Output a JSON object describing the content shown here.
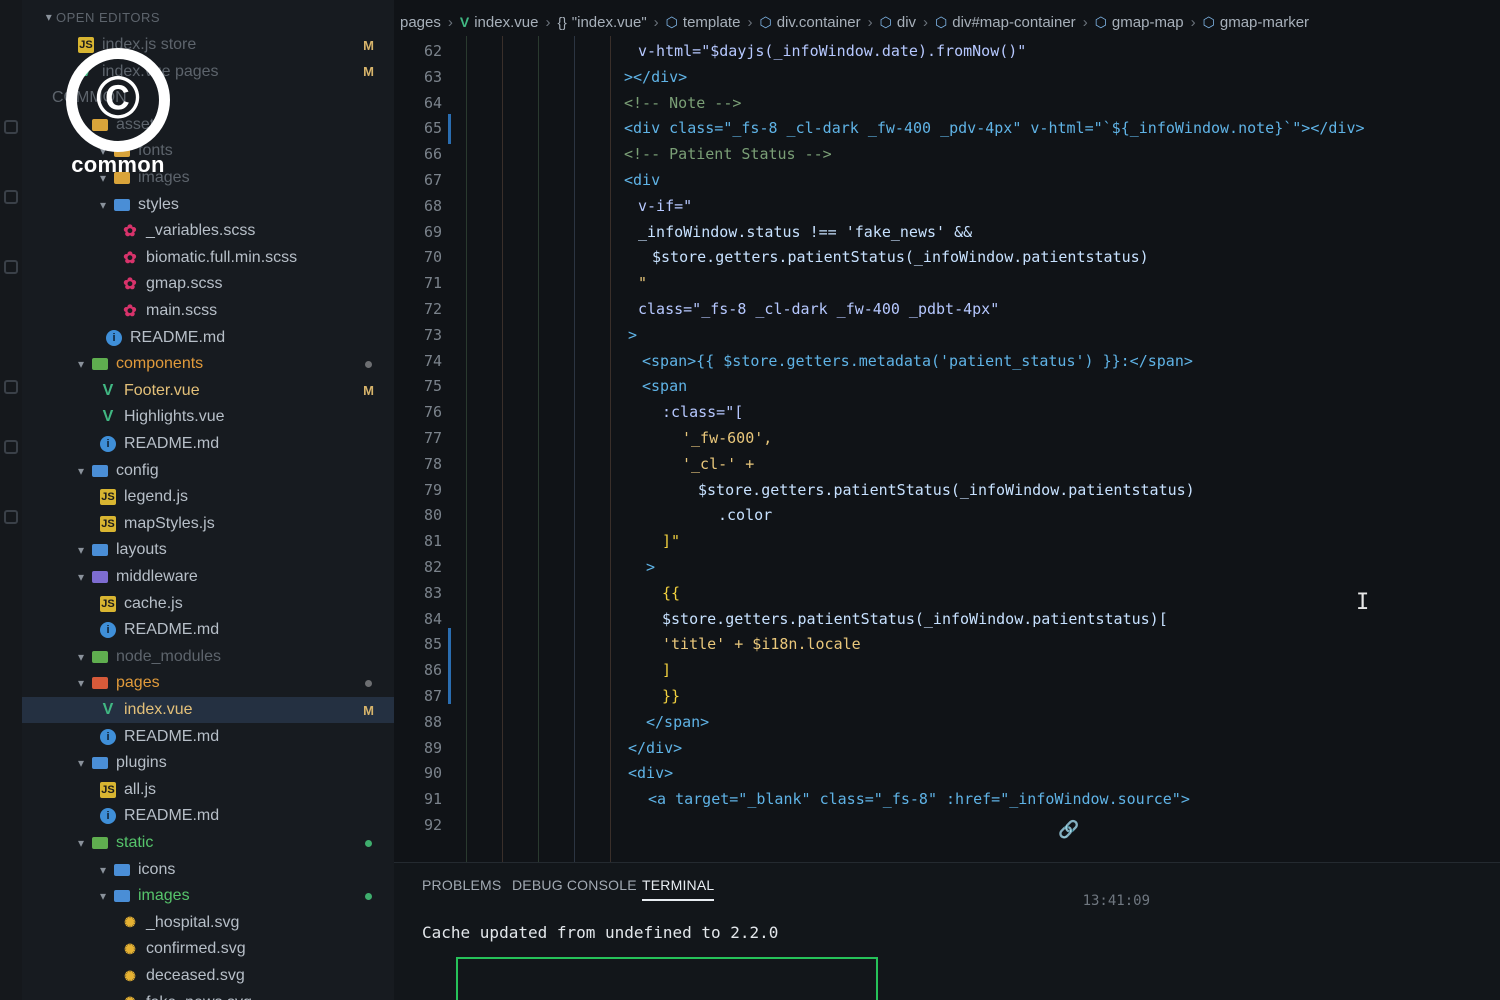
{
  "logo": {
    "symbol": "©",
    "wordmark": "common"
  },
  "sidebar": {
    "section_title": "OPEN EDITORS",
    "items": [
      {
        "label": "index.js store",
        "icon": "js-file-icon",
        "badge": "M",
        "dim": true
      },
      {
        "label": "index.vue pages",
        "icon": "vue-file-icon",
        "badge": "M",
        "dim": true
      },
      {
        "label": "COMMON",
        "icon": "",
        "dim": true
      },
      {
        "label": "assets",
        "icon": "folder-icon",
        "dim": true
      },
      {
        "label": "fonts",
        "icon": "folder-icon",
        "dim": true
      },
      {
        "label": "images",
        "icon": "folder-icon",
        "dim": true
      },
      {
        "label": "styles",
        "icon": "folder-blue-icon",
        "dim": false
      },
      {
        "label": "_variables.scss",
        "icon": "scss-file-icon"
      },
      {
        "label": "biomatic.full.min.scss",
        "icon": "scss-file-icon"
      },
      {
        "label": "gmap.scss",
        "icon": "scss-file-icon"
      },
      {
        "label": "main.scss",
        "icon": "scss-file-icon"
      },
      {
        "label": "README.md",
        "icon": "info-file-icon"
      },
      {
        "label": "components",
        "icon": "folder-green-icon",
        "dot": "grey",
        "color": "orange"
      },
      {
        "label": "Footer.vue",
        "icon": "vue-file-icon",
        "badge": "M",
        "color": "modified"
      },
      {
        "label": "Highlights.vue",
        "icon": "vue-file-icon"
      },
      {
        "label": "README.md",
        "icon": "info-file-icon"
      },
      {
        "label": "config",
        "icon": "folder-blue-icon"
      },
      {
        "label": "legend.js",
        "icon": "js-file-icon"
      },
      {
        "label": "mapStyles.js",
        "icon": "js-file-icon"
      },
      {
        "label": "layouts",
        "icon": "folder-blue-icon"
      },
      {
        "label": "middleware",
        "icon": "folder-purple-icon"
      },
      {
        "label": "cache.js",
        "icon": "js-file-icon"
      },
      {
        "label": "README.md",
        "icon": "info-file-icon"
      },
      {
        "label": "node_modules",
        "icon": "folder-green-icon",
        "dim": true
      },
      {
        "label": "pages",
        "icon": "folder-red-icon",
        "dot": "grey",
        "color": "orange"
      },
      {
        "label": "index.vue",
        "icon": "vue-file-icon",
        "badge": "M",
        "active": true,
        "color": "modified"
      },
      {
        "label": "README.md",
        "icon": "info-file-icon"
      },
      {
        "label": "plugins",
        "icon": "folder-blue-icon"
      },
      {
        "label": "all.js",
        "icon": "js-file-icon"
      },
      {
        "label": "README.md",
        "icon": "info-file-icon"
      },
      {
        "label": "static",
        "icon": "folder-green-icon",
        "dot": "green",
        "color": "green"
      },
      {
        "label": "icons",
        "icon": "folder-blue-icon"
      },
      {
        "label": "images",
        "icon": "folder-blue-icon",
        "dot": "green",
        "color": "green"
      },
      {
        "label": "_hospital.svg",
        "icon": "svg-file-icon"
      },
      {
        "label": "confirmed.svg",
        "icon": "svg-file-icon"
      },
      {
        "label": "deceased.svg",
        "icon": "svg-file-icon"
      },
      {
        "label": "fake_news.svg",
        "icon": "svg-file-icon"
      }
    ]
  },
  "breadcrumb": [
    {
      "label": "pages",
      "icon": ""
    },
    {
      "label": "index.vue",
      "icon": "vue-icon"
    },
    {
      "label": "\"index.vue\"",
      "icon": "braces-icon"
    },
    {
      "label": "template",
      "icon": "cube-icon"
    },
    {
      "label": "div.container",
      "icon": "cube-icon"
    },
    {
      "label": "div",
      "icon": "cube-icon"
    },
    {
      "label": "div#map-container",
      "icon": "cube-icon"
    },
    {
      "label": "gmap-map",
      "icon": "cube-icon"
    },
    {
      "label": "gmap-marker",
      "icon": "cube-icon"
    }
  ],
  "editor": {
    "line_numbers": [
      "62",
      "63",
      "64",
      "65",
      "66",
      "67",
      "68",
      "69",
      "70",
      "71",
      "72",
      "73",
      "74",
      "75",
      "76",
      "77",
      "78",
      "79",
      "80",
      "81",
      "82",
      "83",
      "84",
      "85",
      "86",
      "87",
      "88",
      "89",
      "90",
      "91",
      "92"
    ],
    "code": [
      "v-html=\"$dayjs(_infoWindow.date).fromNow()\"",
      "></div>",
      "<!-- Note -->",
      "<div class=\"_fs-8 _cl-dark _fw-400 _pdv-4px\" v-html=\"`${_infoWindow.note}`\"></div>",
      "<!-- Patient Status -->",
      "<div",
      "v-if=\"",
      "_infoWindow.status !== 'fake_news' &&",
      "$store.getters.patientStatus(_infoWindow.patientstatus)",
      "\"",
      "class=\"_fs-8 _cl-dark _fw-400 _pdbt-4px\"",
      ">",
      "<span>{{ $store.getters.metadata('patient_status') }}:</span>",
      "<span",
      ":class=\"[",
      "'_fw-600',",
      "'_cl-' +",
      "$store.getters.patientStatus(_infoWindow.patientstatus)",
      ".color",
      "]\"",
      ">",
      "{{",
      "$store.getters.patientStatus(_infoWindow.patientstatus)[",
      "'title' + $i18n.locale",
      "]",
      "}}",
      "</span>",
      "</div>",
      "<div>",
      "<a target=\"_blank\" class=\"_fs-8\" :href=\"_infoWindow.source\">"
    ]
  },
  "panel": {
    "tabs": [
      "PROBLEMS",
      "DEBUG CONSOLE",
      "TERMINAL"
    ],
    "active_tab": "TERMINAL",
    "timestamp": "13:41:09",
    "terminal_output": "Cache updated from undefined to 2.2.0"
  },
  "colors": {
    "background": "#101317",
    "sidebar": "#171b20",
    "accent_blue": "#2a6db0",
    "terminal_border": "#26c25a",
    "vue_green": "#41b883"
  }
}
